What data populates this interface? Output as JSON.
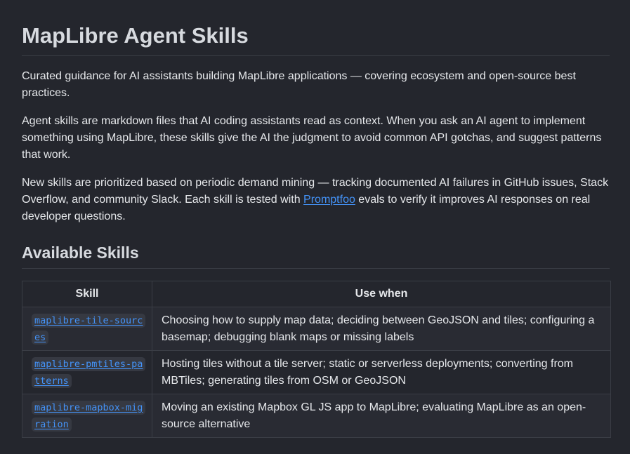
{
  "document": {
    "title": "MapLibre Agent Skills",
    "intro": "Curated guidance for AI assistants building MapLibre applications — covering ecosystem and open-source best practices.",
    "explanation": "Agent skills are markdown files that AI coding assistants read as context. When you ask an AI agent to implement something using MapLibre, these skills give the AI the judgment to avoid common API gotchas, and suggest patterns that work.",
    "prioritization": {
      "before_link": "New skills are prioritized based on periodic demand mining — tracking documented AI failures in GitHub issues, Stack Overflow, and community Slack. Each skill is tested with ",
      "link_text": "Promptfoo",
      "after_link": " evals to verify it improves AI responses on real developer questions."
    },
    "skills_heading": "Available Skills"
  },
  "table": {
    "headers": [
      "Skill",
      "Use when"
    ],
    "rows": [
      {
        "skill": "maplibre-tile-sources",
        "use_when": "Choosing how to supply map data; deciding between GeoJSON and tiles; configuring a basemap; debugging blank maps or missing labels"
      },
      {
        "skill": "maplibre-pmtiles-patterns",
        "use_when": "Hosting tiles without a tile server; static or serverless deployments; converting from MBTiles; generating tiles from OSM or GeoJSON"
      },
      {
        "skill": "maplibre-mapbox-migration",
        "use_when": "Moving an existing Mapbox GL JS app to MapLibre; evaluating MapLibre as an open-source alternative"
      }
    ]
  },
  "colors": {
    "background": "#24262d",
    "text": "#e6e8eb",
    "heading": "#d7dadf",
    "link": "#4493f8",
    "border": "#3a3d45",
    "code_bg": "#363942"
  }
}
